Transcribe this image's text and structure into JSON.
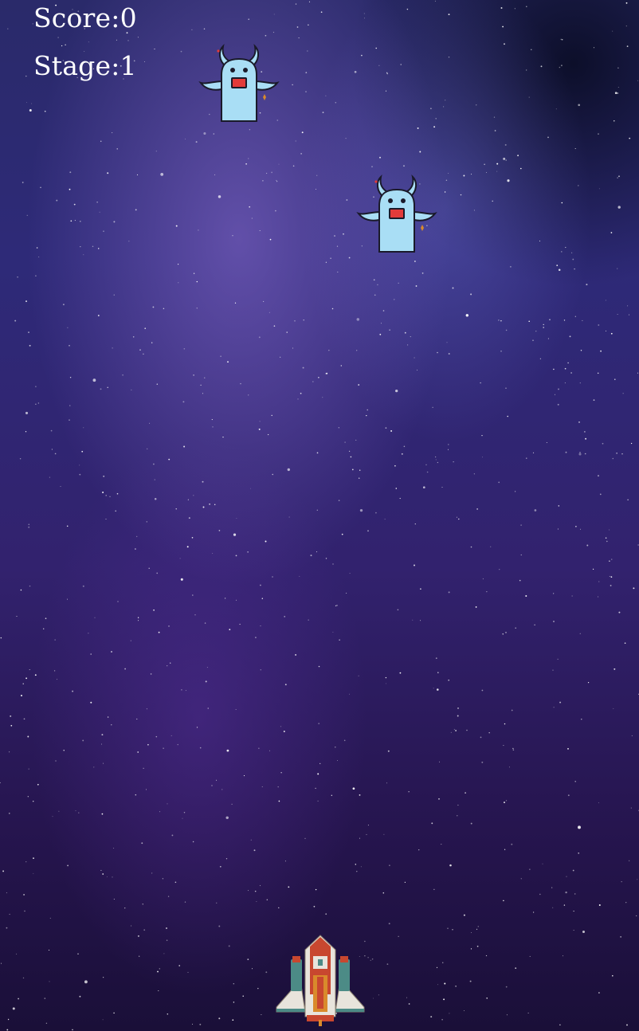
{
  "hud": {
    "score_label": "Score:",
    "score_value": "0",
    "stage_label": "Stage:",
    "stage_value": "1"
  },
  "sprites": {
    "enemy_icon": "horned-monster-icon",
    "player_icon": "spaceship-icon"
  },
  "colors": {
    "hud_text": "#ffffff",
    "monster_body": "#a9def5",
    "monster_mouth": "#e23b3b",
    "ship_body": "#e8e4dc",
    "ship_accent": "#c8472f",
    "ship_core": "#d98a2b",
    "ship_teal": "#4c8b86"
  }
}
